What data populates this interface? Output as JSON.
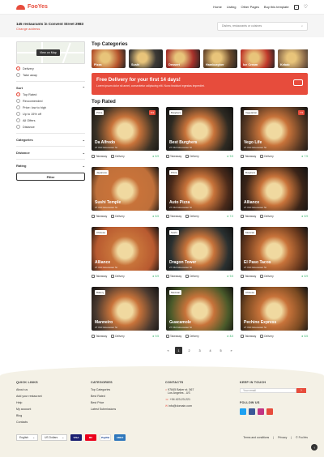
{
  "header": {
    "logo": "FooYes",
    "nav": [
      "Home",
      "Listing",
      "Other Pages",
      "Buy this template"
    ]
  },
  "subheader": {
    "count": "145 restaurants in Convent Street 2983",
    "change": "Change address",
    "search_placeholder": "Dishes, restaurants or cuisines"
  },
  "sidebar": {
    "map_button": "View on Map",
    "service": [
      {
        "label": "Delivery",
        "checked": true
      },
      {
        "label": "Take away",
        "checked": false
      }
    ],
    "sort_title": "Sort",
    "sort": [
      {
        "label": "Top Rated",
        "checked": true
      },
      {
        "label": "Reccomended",
        "checked": false
      },
      {
        "label": "Price: low to high",
        "checked": false
      },
      {
        "label": "Up to 15% off",
        "checked": false
      },
      {
        "label": "All Offers",
        "checked": false
      },
      {
        "label": "Distance",
        "checked": false
      }
    ],
    "filters": [
      "Categories",
      "Distance",
      "Rating"
    ],
    "filter_button": "Filter"
  },
  "categories_title": "Top Categories",
  "categories": [
    {
      "label": "Pizza",
      "color": "#b5542d"
    },
    {
      "label": "Sushi",
      "color": "#3d3a36"
    },
    {
      "label": "Dessert",
      "color": "#a8322b"
    },
    {
      "label": "Hamburgher",
      "color": "#6b4a2c"
    },
    {
      "label": "Ice Cream",
      "color": "#c0392b"
    },
    {
      "label": "Kebab",
      "color": "#8a6a4a"
    }
  ],
  "banner": {
    "title": "Free Delivery for your first 14 days!",
    "text": "Lorem ipsum dolor sit amet, consectetur adipiscing elit. Nunc tincidunt egestas imperdiet."
  },
  "top_rated_title": "Top Rated",
  "restaurants": [
    {
      "name": "Da Alfredo",
      "address": "27 Old Gloucester St",
      "tag": "Pizza",
      "score": "8.9",
      "take": "Takeaway",
      "delivery": "Delivery",
      "rating": "8.9",
      "color": "#3a3226"
    },
    {
      "name": "Best Burghers",
      "address": "27 Old Gloucester St",
      "tag": "Burghers",
      "score": "",
      "take": "Takeaway",
      "delivery": "Delivery",
      "rating": "9.5",
      "color": "#2e2a22"
    },
    {
      "name": "Vego Life",
      "address": "27 Old Gloucester St",
      "tag": "Vegetarian",
      "score": "7.5",
      "take": "Takeaway",
      "delivery": "Delivery",
      "rating": "7.5",
      "color": "#5a3a24"
    },
    {
      "name": "Sushi Temple",
      "address": "27 Old Gloucester St",
      "tag": "Japanese",
      "score": "",
      "take": "Takeaway",
      "delivery": "Delivery",
      "rating": "8.5",
      "color": "#c0703a"
    },
    {
      "name": "Auto Pizza",
      "address": "27 Old Gloucester St",
      "tag": "Pizza",
      "score": "",
      "take": "Takeaway",
      "delivery": "Delivery",
      "rating": "7.0",
      "color": "#4a2a1a"
    },
    {
      "name": "Alliance",
      "address": "27 Old Gloucester St",
      "tag": "Burghers",
      "score": "",
      "take": "Takeaway",
      "delivery": "Delivery",
      "rating": "8.9",
      "color": "#3a2418"
    },
    {
      "name": "Alliance",
      "address": "27 Old Gloucester St",
      "tag": "Chinese",
      "score": "",
      "take": "Takeaway",
      "delivery": "Delivery",
      "rating": "8.9",
      "color": "#b85a30"
    },
    {
      "name": "Dragon Tower",
      "address": "27 Old Gloucester St",
      "tag": "Sushi",
      "score": "",
      "take": "Takeaway",
      "delivery": "Delivery",
      "rating": "9.5",
      "color": "#2a3030"
    },
    {
      "name": "El Paso Tacos",
      "address": "27 Old Gloucester St",
      "tag": "Mexican",
      "score": "",
      "take": "Takeaway",
      "delivery": "Delivery",
      "rating": "8.9",
      "color": "#6a3a1e"
    },
    {
      "name": "Manneiro",
      "address": "27 Old Gloucester St",
      "tag": "Bakery",
      "score": "",
      "take": "Takeaway",
      "delivery": "Delivery",
      "rating": "9.5",
      "color": "#4a3a30"
    },
    {
      "name": "Guacamole",
      "address": "27 Old Gloucester St",
      "tag": "Mexican",
      "score": "",
      "take": "Takeaway",
      "delivery": "Delivery",
      "rating": "8.5",
      "color": "#4a5a2a"
    },
    {
      "name": "Pechino Express",
      "address": "27 Old Gloucester St",
      "tag": "Chinese",
      "score": "",
      "take": "Takeaway",
      "delivery": "Delivery",
      "rating": "8.5",
      "color": "#7a4a22"
    }
  ],
  "pagination": [
    "«",
    "1",
    "2",
    "3",
    "4",
    "5",
    "»"
  ],
  "footer": {
    "quick_title": "QUICK LINKS",
    "quick": [
      "About us",
      "Add your restaurant",
      "Help",
      "My account",
      "Blog",
      "Contacts"
    ],
    "cat_title": "CATEGORIES",
    "cats": [
      "Top Categories",
      "Best Rated",
      "Best Price",
      "Latest Submissions"
    ],
    "contacts_title": "CONTACTS",
    "contacts": [
      "97845 Baker st. 567",
      "Los Angeles - US",
      "+94 423-23-221",
      "info@domain.com"
    ],
    "keep_title": "KEEP IN TOUCH",
    "email_placeholder": "Your email",
    "follow_title": "FOLLOW US",
    "social_colors": [
      "#1da1f2",
      "#3b5998",
      "#c13584",
      "#e74c3c"
    ],
    "language": "English",
    "currency": "US Dollars",
    "payments": [
      "VISA",
      "MC",
      "PayPal",
      "AMEX"
    ],
    "links": [
      "Terms and conditions",
      "Privacy",
      "© FooYes"
    ]
  }
}
